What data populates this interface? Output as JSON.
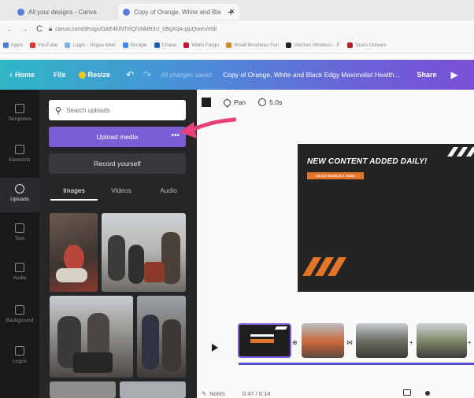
{
  "browser": {
    "tabs": [
      {
        "label": "All your designs - Canva",
        "active": false
      },
      {
        "label": "Copy of Orange, White and Bla",
        "active": true
      }
    ],
    "new_tab_icon": "plus-icon",
    "url": "canva.com/design/DAE4kINTRQ/1NMB3U_0BgXqA-pjuQwen/edit"
  },
  "bookmarks": [
    {
      "label": "Apps",
      "color": "#4a7bd0"
    },
    {
      "label": "YouTube",
      "color": "#e0342b"
    },
    {
      "label": "Login - Vegas Med",
      "color": "#7bb2e8"
    },
    {
      "label": "Google",
      "color": "#4285f4"
    },
    {
      "label": "Chase",
      "color": "#1b5fb0"
    },
    {
      "label": "Wells Fargo",
      "color": "#c8102e"
    },
    {
      "label": "Small Business Fun",
      "color": "#d48a2a"
    },
    {
      "label": "Verizon Wireless - F",
      "color": "#222222"
    },
    {
      "label": "Touro Univers",
      "color": "#b8202a"
    }
  ],
  "header": {
    "home": "Home",
    "file": "File",
    "resize": "Resize",
    "saved_status": "All changes saved",
    "title": "Copy of Orange, White and Black Edgy Maximalist Health...",
    "share": "Share"
  },
  "rail": [
    {
      "label": "Templates",
      "icon": "templates-icon",
      "active": false
    },
    {
      "label": "Elements",
      "icon": "elements-icon",
      "active": false
    },
    {
      "label": "Uploads",
      "icon": "uploads-icon",
      "active": true
    },
    {
      "label": "Text",
      "icon": "text-icon",
      "active": false
    },
    {
      "label": "Audio",
      "icon": "audio-icon",
      "active": false
    },
    {
      "label": "Background",
      "icon": "background-icon",
      "active": false
    },
    {
      "label": "Logos",
      "icon": "logos-icon",
      "active": false
    }
  ],
  "panel": {
    "search_placeholder": "Search uploads",
    "upload_label": "Upload media",
    "upload_more": "•••",
    "record_label": "Record yourself",
    "tabs": [
      {
        "label": "Images",
        "active": true
      },
      {
        "label": "Videos",
        "active": false
      },
      {
        "label": "Audio",
        "active": false
      }
    ]
  },
  "toolbar": {
    "pan_label": "Pan",
    "duration": "5.0s"
  },
  "canvas": {
    "headline": "NEW CONTENT ADDED DAILY!",
    "cta": "WATCH WORKOUT VIDEO",
    "accent": "#e4762a"
  },
  "timeline": {
    "accent": "#5b4fcf"
  },
  "footer": {
    "notes_label": "Notes",
    "time": "0:47 / 6:14"
  }
}
